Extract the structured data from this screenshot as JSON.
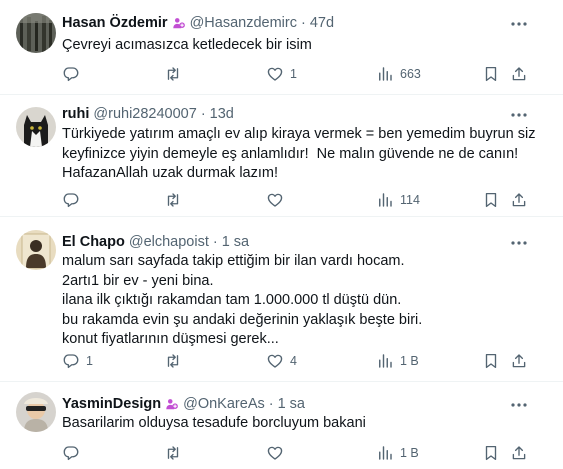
{
  "tweets": [
    {
      "name": "Hasan Özdemir",
      "handle": "@Hasanzdemirc",
      "time": "47d",
      "text": "Çevreyi acımasızca ketledecek bir isim",
      "replies": "",
      "retweets": "",
      "likes": "1",
      "views": "663",
      "badge": "people-icon"
    },
    {
      "name": "ruhi",
      "handle": "@ruhi28240007",
      "time": "13d",
      "text": "Türkiyede yatırım amaçlı ev alıp kiraya vermek = ben yemedim buyrun siz keyfinizce yiyin demeyle eş anlamlıdır!  Ne malın güvende ne de canın! HafazanAllah uzak durmak lazım!",
      "replies": "",
      "retweets": "",
      "likes": "",
      "views": "114"
    },
    {
      "name": "El Chapo",
      "handle": "@elchapoist",
      "time": "1 sa",
      "text": "malum sarı sayfada takip ettiğim bir ilan vardı hocam.\n2artı1 bir ev - yeni bina.\nilana ilk çıktığı rakamdan tam 1.000.000 tl düştü dün.\nbu rakamda evin şu andaki değerinin yaklaşık beşte biri.\nkonut fiyatlarının düşmesi gerek...",
      "replies": "1",
      "retweets": "",
      "likes": "4",
      "views": "1 B"
    },
    {
      "name": "YasminDesign",
      "handle": "@OnKareAs",
      "time": "1 sa",
      "text": "Basarilarim olduysa tesadufe borcluyum bakani",
      "replies": "",
      "retweets": "",
      "likes": "",
      "views": "1 B",
      "badge": "people-icon"
    }
  ],
  "colors": {
    "text": "#0f1419",
    "muted": "#536471",
    "badge": "#c24fd3",
    "divider": "#eff3f4"
  }
}
